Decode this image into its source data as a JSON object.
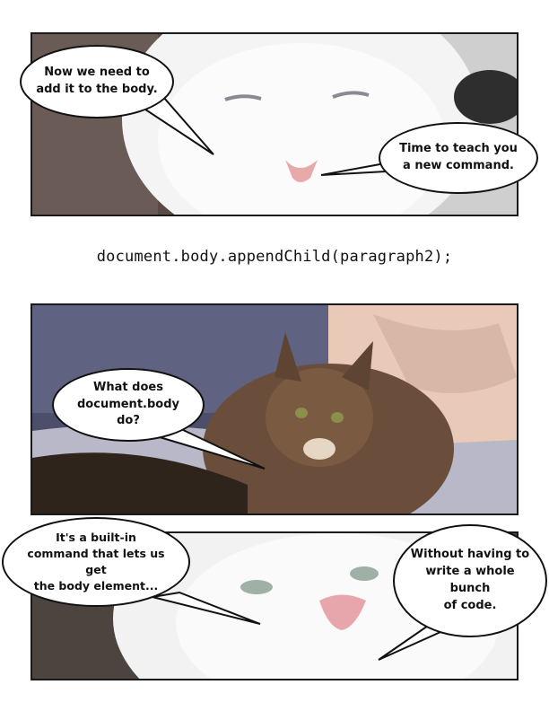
{
  "panels": [
    {
      "bubbles": [
        {
          "text": "Now we need to\nadd it to the body."
        },
        {
          "text": "Time to teach you\na new command."
        }
      ]
    },
    {
      "bubbles": [
        {
          "text": "What does\ndocument.body do?"
        }
      ]
    },
    {
      "bubbles": [
        {
          "text": "It's a built-in\ncommand that lets us get\nthe body element..."
        },
        {
          "text": "Without having to\nwrite a whole bunch\nof code."
        }
      ]
    }
  ],
  "code": "document.body.appendChild(paragraph2);"
}
